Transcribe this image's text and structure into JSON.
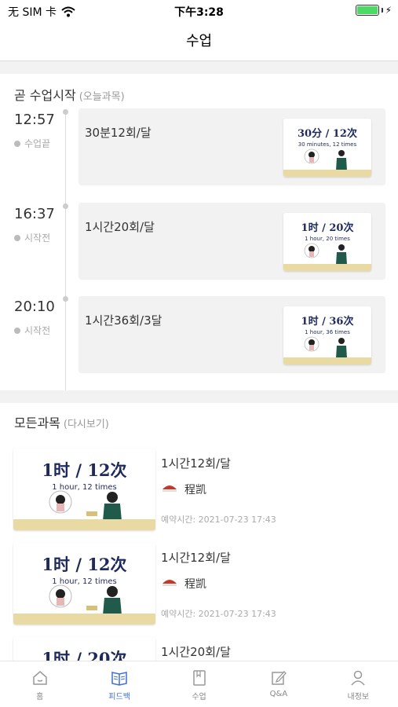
{
  "status_bar": {
    "carrier": "无 SIM 卡",
    "time": "下午3:28",
    "battery_level": 1.0
  },
  "nav": {
    "title": "수업"
  },
  "today": {
    "heading": "곧 수업시작",
    "heading_sub": "(오늘과목)",
    "lessons": [
      {
        "time": "12:57",
        "status": "수업끝",
        "name": "30분12회/달",
        "thumb_big": "30分 / 12次",
        "thumb_small": "30 minutes, 12 times"
      },
      {
        "time": "16:37",
        "status": "시작전",
        "name": "1시간20회/달",
        "thumb_big": "1时 / 20次",
        "thumb_small": "1 hour, 20 times"
      },
      {
        "time": "20:10",
        "status": "시작전",
        "name": "1시간36회/3달",
        "thumb_big": "1时 / 36次",
        "thumb_small": "1 hour, 36 times"
      }
    ]
  },
  "all_courses": {
    "heading": "모든과목",
    "heading_sub": "(다시보기)",
    "courses": [
      {
        "title": "1시간12회/달",
        "teacher": "程凯",
        "booking": "예약시간:  2021-07-23 17:43",
        "thumb_big": "1时 / 12次",
        "thumb_small": "1 hour, 12 times"
      },
      {
        "title": "1시간12회/달",
        "teacher": "程凯",
        "booking": "예약시간:  2021-07-23 17:43",
        "thumb_big": "1时 / 12次",
        "thumb_small": "1 hour, 12 times"
      },
      {
        "title": "1시간20회/달",
        "thumb_big": "1时 / 20次"
      }
    ]
  },
  "tabs": [
    {
      "label": "홈",
      "icon": "home-icon"
    },
    {
      "label": "피드백",
      "icon": "book-icon",
      "active": true
    },
    {
      "label": "수업",
      "icon": "class-icon"
    },
    {
      "label": "Q&A",
      "icon": "edit-icon"
    },
    {
      "label": "내정보",
      "icon": "person-icon"
    }
  ],
  "colors": {
    "accent": "#3f6fd8",
    "thumb_text": "#1f2a5c",
    "desk": "#e9d9a3"
  }
}
